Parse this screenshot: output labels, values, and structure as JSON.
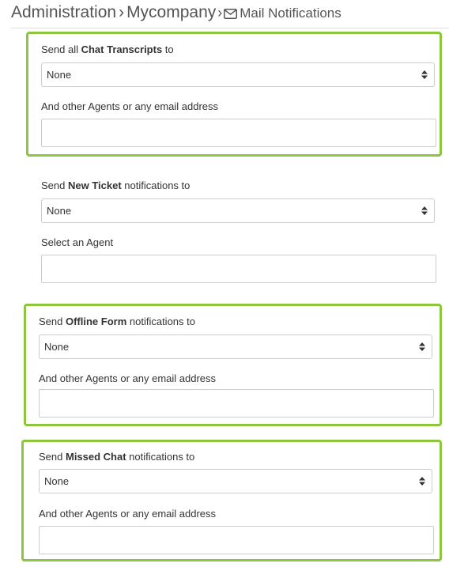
{
  "breadcrumb": {
    "items": [
      "Administration",
      "Mycompany",
      "Mail Notifications"
    ],
    "separator": "›"
  },
  "icons": {
    "mail": "envelope-icon",
    "select_caret": "up-down-caret-icon"
  },
  "colors": {
    "highlight_border": "#8cc63f",
    "input_border": "#cccccc"
  },
  "sections": {
    "chat_transcripts": {
      "label_before": "Send all ",
      "label_bold": "Chat Transcripts",
      "label_after": " to",
      "select_value": "None",
      "sub_label": "And other Agents or any email address",
      "input_value": "",
      "highlighted": true
    },
    "new_ticket": {
      "label_before": "Send ",
      "label_bold": "New Ticket",
      "label_after": " notifications to",
      "select_value": "None",
      "sub_label": "Select an Agent",
      "input_value": "",
      "highlighted": false
    },
    "offline_form": {
      "label_before": "Send ",
      "label_bold": "Offline Form",
      "label_after": " notifications to",
      "select_value": "None",
      "sub_label": "And other Agents or any email address",
      "input_value": "",
      "highlighted": true
    },
    "missed_chat": {
      "label_before": "Send ",
      "label_bold": "Missed Chat",
      "label_after": " notifications to",
      "select_value": "None",
      "sub_label": "And other Agents or any email address",
      "input_value": "",
      "highlighted": true
    }
  }
}
